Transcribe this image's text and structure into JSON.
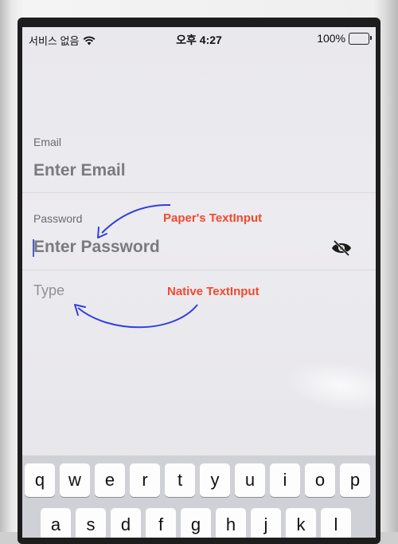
{
  "status_bar": {
    "carrier": "서비스 없음",
    "time": "오후 4:27",
    "battery": "100%",
    "battery_level": 1.0
  },
  "form": {
    "email": {
      "label": "Email",
      "placeholder": "Enter Email"
    },
    "password": {
      "label": "Password",
      "placeholder": "Enter Password"
    },
    "native": {
      "placeholder": "Type"
    }
  },
  "annotations": {
    "paper": "Paper's TextInput",
    "native": "Native TextInput",
    "arrow_color": "#2f3fe0",
    "text_color": "#f04a2e"
  },
  "keyboard": {
    "row1": [
      "q",
      "w",
      "e",
      "r",
      "t",
      "y",
      "u",
      "i",
      "o",
      "p"
    ],
    "row2": [
      "a",
      "s",
      "d",
      "f",
      "g",
      "h",
      "j",
      "k",
      "l"
    ]
  },
  "icons": {
    "wifi": "wifi-icon",
    "battery": "battery-charging-icon",
    "visibility": "eye-off-icon"
  }
}
